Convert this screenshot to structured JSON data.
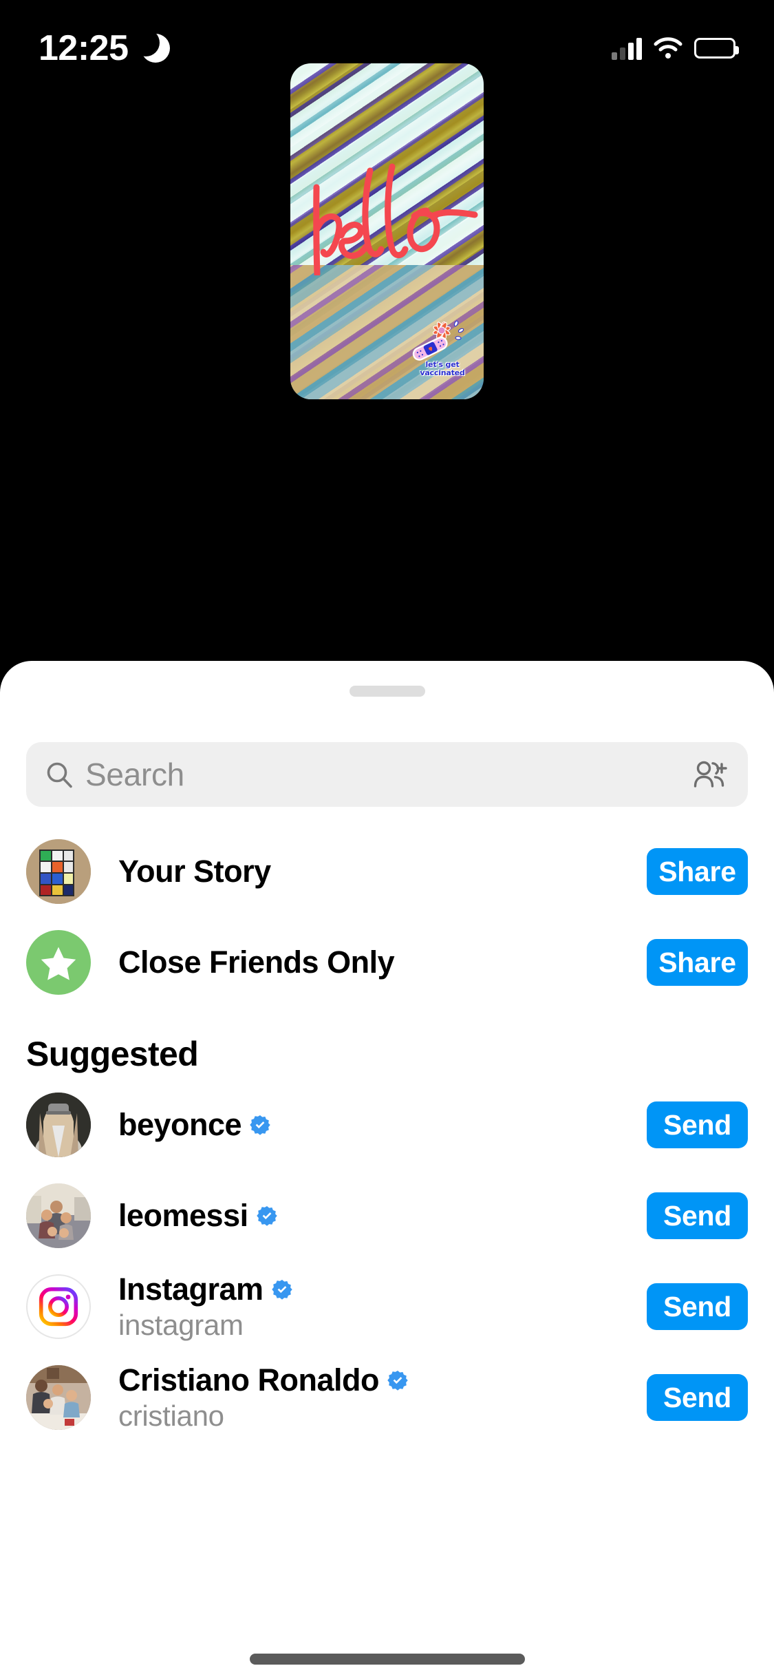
{
  "status_bar": {
    "time": "12:25",
    "dnd_icon": "crescent-moon-icon",
    "signal_icon": "cellular-signal-icon",
    "wifi_icon": "wifi-icon",
    "battery_icon": "battery-icon"
  },
  "story_preview": {
    "overlay_text": "hello",
    "overlay_text_color": "#F4474F",
    "sticker": {
      "line1": "let's get",
      "line2": "vaccinated",
      "text_color": "#2b2fcf",
      "art": "bandage-and-flower-icon"
    },
    "background_description": "diagonal-striped-abstract-pattern"
  },
  "sheet": {
    "grabber": "sheet-grabber",
    "search": {
      "placeholder": "Search",
      "value": "",
      "search_icon": "search-icon",
      "add_people_icon": "add-people-icon"
    },
    "primary_rows": [
      {
        "title": "Your Story",
        "subtitle": "",
        "verified": false,
        "action_label": "Share",
        "avatar": "rubiks-cube-photo"
      },
      {
        "title": "Close Friends Only",
        "subtitle": "",
        "verified": false,
        "action_label": "Share",
        "avatar": "green-star-icon"
      }
    ],
    "section_title": "Suggested",
    "suggested_rows": [
      {
        "title": "beyonce",
        "subtitle": "",
        "verified": true,
        "action_label": "Send",
        "avatar": "beyonce-photo"
      },
      {
        "title": "leomessi",
        "subtitle": "",
        "verified": true,
        "action_label": "Send",
        "avatar": "leomessi-photo"
      },
      {
        "title": "Instagram",
        "subtitle": "instagram",
        "verified": true,
        "action_label": "Send",
        "avatar": "instagram-logo"
      },
      {
        "title": "Cristiano Ronaldo",
        "subtitle": "cristiano",
        "verified": true,
        "action_label": "Send",
        "avatar": "cristiano-photo"
      }
    ]
  },
  "colors": {
    "accent_blue": "#0095F6",
    "verified_blue": "#3897F0",
    "close_friends_green": "#7BC96F",
    "search_background": "#EFEFEF",
    "subtitle_gray": "#8E8E8E"
  },
  "home_indicator": "home-indicator"
}
